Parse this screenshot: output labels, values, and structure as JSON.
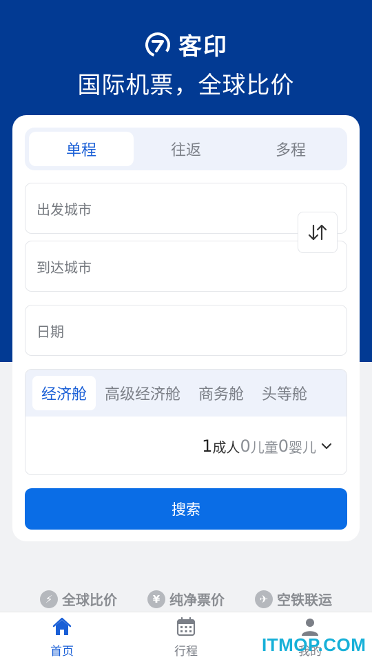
{
  "brand": {
    "name": "客印",
    "slogan": "国际机票，全球比价"
  },
  "trip_tabs": [
    {
      "label": "单程",
      "active": true
    },
    {
      "label": "往返",
      "active": false
    },
    {
      "label": "多程",
      "active": false
    }
  ],
  "fields": {
    "departure_placeholder": "出发城市",
    "arrival_placeholder": "到达城市",
    "date_placeholder": "日期"
  },
  "cabin_tabs": [
    {
      "label": "经济舱",
      "active": true
    },
    {
      "label": "高级经济舱",
      "active": false
    },
    {
      "label": "商务舱",
      "active": false
    },
    {
      "label": "头等舱",
      "active": false
    }
  ],
  "passengers": {
    "adults_count": "1",
    "adults_label": "成人",
    "children_count": "0",
    "children_label": "儿童",
    "infants_count": "0",
    "infants_label": "婴儿"
  },
  "search_label": "搜索",
  "features": [
    {
      "label": "全球比价",
      "icon": "lightning-icon"
    },
    {
      "label": "纯净票价",
      "icon": "yen-icon"
    },
    {
      "label": "空铁联运",
      "icon": "train-icon"
    }
  ],
  "tabbar": [
    {
      "label": "首页",
      "icon": "home-icon",
      "active": true
    },
    {
      "label": "行程",
      "icon": "calendar-icon",
      "active": false
    },
    {
      "label": "我的",
      "icon": "user-icon",
      "active": false
    }
  ],
  "watermark": "ITMOP.COM",
  "colors": {
    "hero_bg": "#023a93",
    "accent": "#1a5fd6",
    "button": "#0a6de6"
  }
}
